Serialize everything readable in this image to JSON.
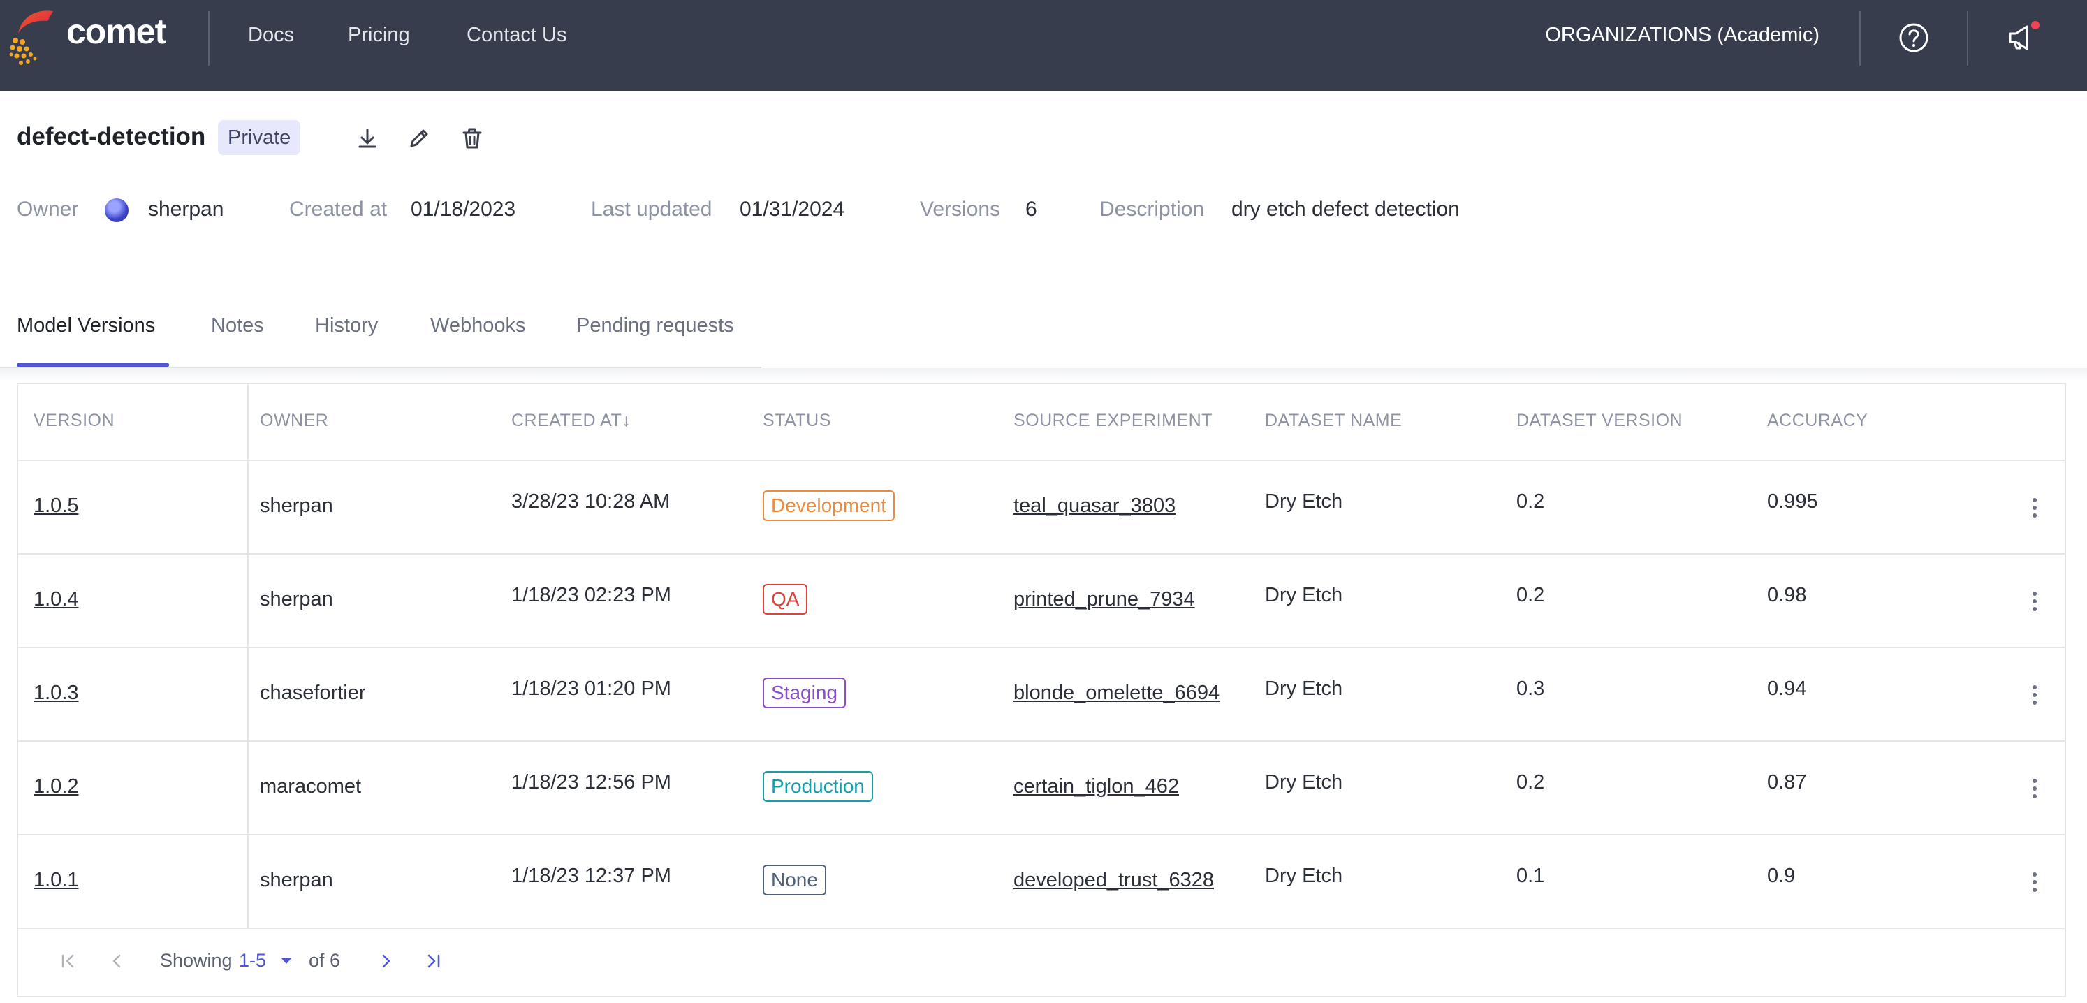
{
  "nav": {
    "brand": "comet",
    "links": [
      "Docs",
      "Pricing",
      "Contact Us"
    ],
    "organization": "ORGANIZATIONS (Academic)",
    "icons": [
      "help-icon",
      "announcement-icon"
    ]
  },
  "header": {
    "title": "defect-detection",
    "visibility": "Private",
    "actions": [
      "download-icon",
      "edit-icon",
      "delete-icon"
    ],
    "meta": {
      "owner_label": "Owner",
      "owner": "sherpan",
      "created_label": "Created at",
      "created": "01/18/2023",
      "updated_label": "Last updated",
      "updated": "01/31/2024",
      "versions_label": "Versions",
      "versions": "6",
      "description_label": "Description",
      "description": "dry etch defect detection"
    }
  },
  "tabs": [
    {
      "label": "Model Versions",
      "active": true
    },
    {
      "label": "Notes"
    },
    {
      "label": "History"
    },
    {
      "label": "Webhooks"
    },
    {
      "label": "Pending requests"
    }
  ],
  "table": {
    "columns": [
      "VERSION",
      "OWNER",
      "CREATED AT",
      "STATUS",
      "SOURCE EXPERIMENT",
      "DATASET NAME",
      "DATASET VERSION",
      "ACCURACY"
    ],
    "sort_indicator": "↓",
    "rows": [
      {
        "version": "1.0.5",
        "owner": "sherpan",
        "created": "3/28/23 10:28 AM",
        "status": "Development",
        "experiment": "teal_quasar_3803",
        "dataset": "Dry Etch",
        "dataset_version": "0.2",
        "accuracy": "0.995"
      },
      {
        "version": "1.0.4",
        "owner": "sherpan",
        "created": "1/18/23 02:23 PM",
        "status": "QA",
        "experiment": "printed_prune_7934",
        "dataset": "Dry Etch",
        "dataset_version": "0.2",
        "accuracy": "0.98"
      },
      {
        "version": "1.0.3",
        "owner": "chasefortier",
        "created": "1/18/23 01:20 PM",
        "status": "Staging",
        "experiment": "blonde_omelette_6694",
        "dataset": "Dry Etch",
        "dataset_version": "0.3",
        "accuracy": "0.94"
      },
      {
        "version": "1.0.2",
        "owner": "maracomet",
        "created": "1/18/23 12:56 PM",
        "status": "Production",
        "experiment": "certain_tiglon_462",
        "dataset": "Dry Etch",
        "dataset_version": "0.2",
        "accuracy": "0.87"
      },
      {
        "version": "1.0.1",
        "owner": "sherpan",
        "created": "1/18/23 12:37 PM",
        "status": "None",
        "experiment": "developed_trust_6328",
        "dataset": "Dry Etch",
        "dataset_version": "0.1",
        "accuracy": "0.9"
      }
    ]
  },
  "status_colors": {
    "Development": "#ee8a3c",
    "QA": "#e0413d",
    "Staging": "#8a4cc9",
    "Production": "#159fa8",
    "None": "#4f6078"
  },
  "pagination": {
    "showing_label": "Showing",
    "range": "1-5",
    "of_label": "of 6"
  },
  "colors": {
    "nav_bg": "#373d4d",
    "accent": "#5155d6"
  }
}
